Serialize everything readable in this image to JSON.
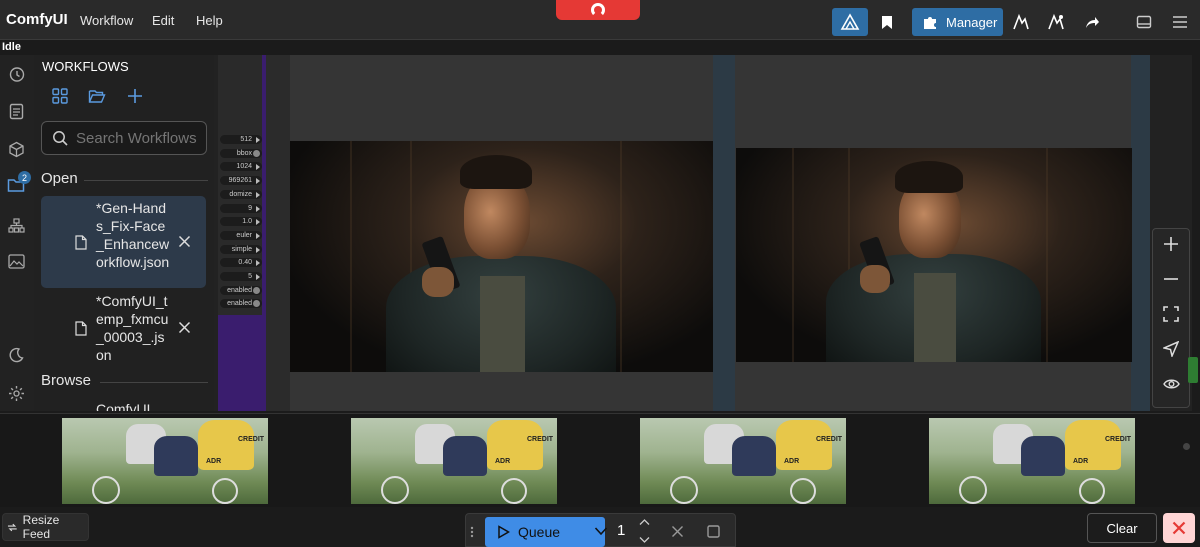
{
  "app": {
    "title": "ComfyUI",
    "menu": [
      "Workflow",
      "Edit",
      "Help"
    ],
    "status": "Idle"
  },
  "toolbar": {
    "manager_label": "Manager",
    "icons": [
      "comfy-logo-icon",
      "bookmark-icon",
      "puzzle-icon",
      "graph-icon",
      "graph-alt-icon",
      "share-icon",
      "panel-toggle-icon",
      "hamburger-icon"
    ]
  },
  "sidebar": {
    "rail_icons": [
      "history-icon",
      "document-icon",
      "cube-icon",
      "folder-icon",
      "sitemap-icon",
      "image-icon",
      "moon-icon",
      "gear-icon"
    ],
    "badge_count": "2"
  },
  "workflows": {
    "title": "WORKFLOWS",
    "search_placeholder": "Search Workflows",
    "open_label": "Open",
    "browse_label": "Browse",
    "open_items": [
      {
        "name": "*Gen-Hands_Fix-Face_Enhanceworkflow.json",
        "active": true
      },
      {
        "name": "*ComfyUI_temp_fxmcu_00003_.json",
        "active": false
      }
    ],
    "browse_items": [
      {
        "name": "ComfyUI"
      }
    ]
  },
  "node_widgets": [
    {
      "value": "512",
      "kind": "arrow"
    },
    {
      "value": "bbox",
      "kind": "toggle"
    },
    {
      "value": "1024",
      "kind": "arrow"
    },
    {
      "value": "969261",
      "kind": "arrow"
    },
    {
      "value": "domize",
      "kind": "arrow"
    },
    {
      "value": "9",
      "kind": "arrow"
    },
    {
      "value": "1.0",
      "kind": "arrow"
    },
    {
      "value": "euler",
      "kind": "arrow"
    },
    {
      "value": "simple",
      "kind": "arrow"
    },
    {
      "value": "0.40",
      "kind": "arrow"
    },
    {
      "value": "5",
      "kind": "arrow"
    },
    {
      "value": "enabled",
      "kind": "toggle"
    },
    {
      "value": "enabled",
      "kind": "toggle"
    }
  ],
  "canvas_tools": [
    "zoom-in-icon",
    "zoom-out-icon",
    "fit-view-icon",
    "navigate-icon",
    "eye-icon"
  ],
  "queue": {
    "label": "Queue",
    "count": "1"
  },
  "feed": {
    "resize_label": "Resize Feed",
    "thumbnail_count": 4,
    "thumb_logos": [
      "CREDIT",
      "ADR"
    ]
  },
  "footer": {
    "clear_label": "Clear"
  },
  "colors": {
    "accent": "#2e6da4",
    "queue_blue": "#3f8ce6",
    "danger": "#e53935",
    "node_purple": "#3a1d6e"
  }
}
